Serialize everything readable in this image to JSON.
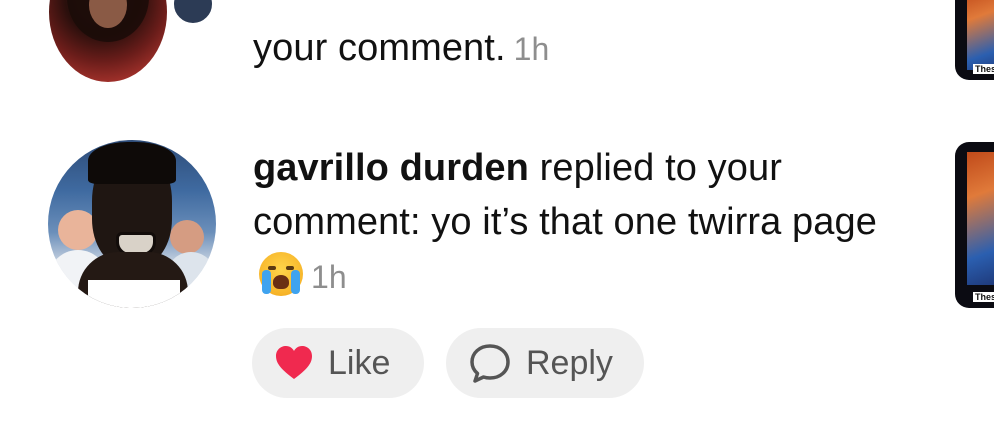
{
  "notifications": [
    {
      "text": "your comment.",
      "time": "1h"
    },
    {
      "username": "gavrillo durden",
      "text": " replied to your comment: yo it’s that one twirra page ",
      "emoji": "loudly-crying-face",
      "time": "1h"
    }
  ],
  "actions": {
    "like_label": "Like",
    "reply_label": "Reply"
  },
  "thumbnails": {
    "caption": "Thes"
  },
  "colors": {
    "like_heart": "#f0294f",
    "pill_bg": "#efefef",
    "timestamp": "#8e8e8e"
  }
}
